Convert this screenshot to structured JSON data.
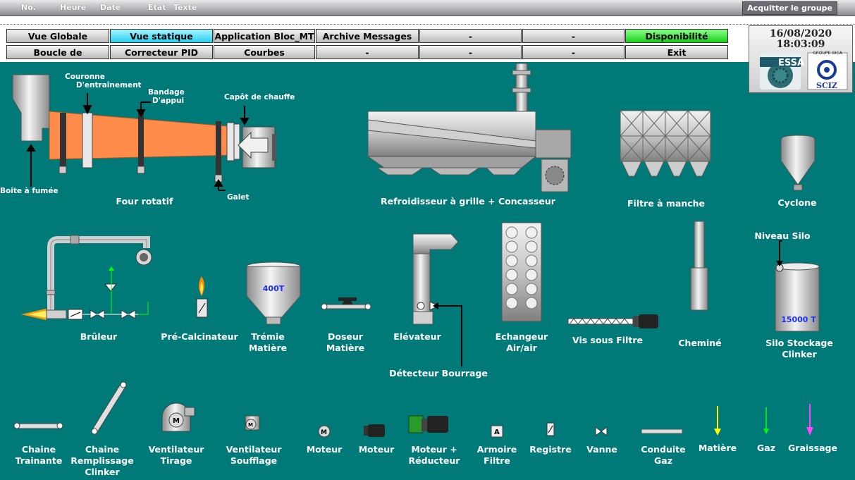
{
  "alarm": {
    "col_no": "No.",
    "col_heure": "Heure",
    "col_date": "Date",
    "col_etat": "Etat",
    "col_texte": "Texte",
    "ack_button": "Acquitter le groupe"
  },
  "nav": {
    "row1": [
      "Vue Globale",
      "Vue statique",
      "Application Bloc_MT",
      "Archive Messages",
      "-",
      "-",
      "Disponibilité"
    ],
    "row2": [
      "Boucle de Régulation",
      "Correcteur PID",
      "Courbes",
      "-",
      "-",
      "-",
      "Exit"
    ],
    "active": "Vue statique"
  },
  "header": {
    "date": "16/08/2020",
    "time": "18:03:09",
    "logo_left": "ESSA",
    "logo_right_caption": "GROUPE GICA",
    "logo_right": "SCIZ"
  },
  "equipment": {
    "couronne": "Couronne D'entraînement",
    "couronne_l1": "Couronne",
    "couronne_l2": "D'entraînement",
    "bandage_l1": "Bandage",
    "bandage_l2": "D'appui",
    "capot": "Capôt de chauffe",
    "boite": "Boite à fumée",
    "four": "Four rotatif",
    "galet": "Galet",
    "refroidisseur": "Refroidisseur à grille + Concasseur",
    "filtre": "Filtre à manche",
    "cyclone": "Cyclone",
    "bruleur": "Brûleur",
    "precalcinateur": "Pré-Calcinateur",
    "tremie_l1": "Trémie",
    "tremie_l2": "Matière",
    "tremie_value": "400T",
    "doseur_l1": "Doseur",
    "doseur_l2": "Matière",
    "elevateur": "Elévateur",
    "detecteur": "Détecteur Bourrage",
    "echangeur_l1": "Echangeur",
    "echangeur_l2": "Air/air",
    "vis": "Vis sous Filtre",
    "chemine": "Cheminé",
    "niveau_silo": "Niveau Silo",
    "silo_l1": "Silo Stockage",
    "silo_l2": "Clinker",
    "silo_value": "15000 T"
  },
  "legend": {
    "chaine_trainante": [
      "Chaine",
      "Trainante"
    ],
    "chaine_remplissage": [
      "Chaine",
      "Remplissage",
      "Clinker"
    ],
    "ventilateur_tirage": [
      "Ventilateur",
      "Tirage"
    ],
    "ventilateur_soufflage": [
      "Ventilateur",
      "Soufflage"
    ],
    "moteur1": "Moteur",
    "moteur2": "Moteur",
    "moteur_reducteur": [
      "Moteur +",
      "Réducteur"
    ],
    "armoire": [
      "Armoire",
      "Filtre"
    ],
    "armoire_icon_text": "A",
    "registre": "Registre",
    "vanne": "Vanne",
    "conduite": [
      "Conduite",
      "Gaz"
    ],
    "matiere": "Matière",
    "gaz": "Gaz",
    "graissage": "Graissage"
  },
  "colors": {
    "background": "#007a78",
    "kiln": "#ff8c4a",
    "matiere_arrow": "#ffff00",
    "gaz_arrow": "#00ff00",
    "graissage_arrow": "#ff44ff",
    "active_tab": "#28d0f0",
    "availability_tab": "#18d018"
  }
}
